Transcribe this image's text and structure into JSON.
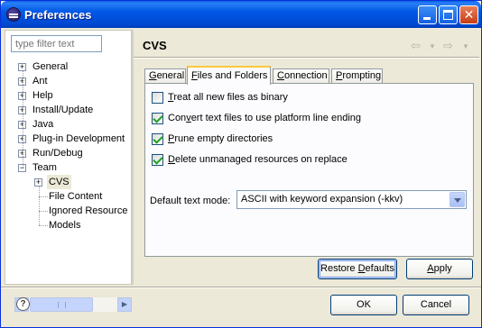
{
  "window": {
    "title": "Preferences",
    "controls": {
      "minimize": "minimize",
      "maximize": "maximize",
      "close": "✕"
    }
  },
  "sidebar": {
    "filter_placeholder": "type filter text",
    "tree": [
      {
        "label": "General",
        "expander": "+",
        "level": 0
      },
      {
        "label": "Ant",
        "expander": "+",
        "level": 0
      },
      {
        "label": "Help",
        "expander": "+",
        "level": 0
      },
      {
        "label": "Install/Update",
        "expander": "+",
        "level": 0
      },
      {
        "label": "Java",
        "expander": "+",
        "level": 0
      },
      {
        "label": "Plug-in Development",
        "expander": "+",
        "level": 0
      },
      {
        "label": "Run/Debug",
        "expander": "+",
        "level": 0
      },
      {
        "label": "Team",
        "expander": "−",
        "level": 0
      },
      {
        "label": "CVS",
        "expander": "+",
        "level": 1,
        "selected": true
      },
      {
        "label": "File Content",
        "level": 1
      },
      {
        "label": "Ignored Resource",
        "level": 1
      },
      {
        "label": "Models",
        "level": 1
      }
    ]
  },
  "page": {
    "title": "CVS",
    "tabs": [
      {
        "label": "General",
        "mnemonic": "G",
        "rest": "eneral"
      },
      {
        "label": "Files and Folders",
        "mnemonic": "F",
        "rest": "iles and Folders",
        "active": true
      },
      {
        "label": "Connection",
        "mnemonic": "C",
        "rest": "onnection"
      },
      {
        "label": "Prompting",
        "mnemonic": "P",
        "rest": "rompting"
      }
    ],
    "options": [
      {
        "pre": "",
        "mnemonic": "T",
        "rest": "reat all new files as binary",
        "checked": false
      },
      {
        "pre": "Con",
        "mnemonic": "v",
        "rest": "ert text files to use platform line ending",
        "checked": true
      },
      {
        "pre": "",
        "mnemonic": "P",
        "rest": "rune empty directories",
        "checked": true
      },
      {
        "pre": "",
        "mnemonic": "D",
        "rest": "elete unmanaged resources on replace",
        "checked": true
      }
    ],
    "text_mode_label": "Default text mode:",
    "text_mode_value": "ASCII with keyword expansion (-kkv)",
    "restore_defaults": {
      "mnemonic": "D",
      "pre": "Restore ",
      "rest": "efaults"
    },
    "apply": {
      "mnemonic": "A",
      "rest": "pply"
    }
  },
  "footer": {
    "help_label": "?",
    "ok": "OK",
    "cancel": "Cancel"
  }
}
